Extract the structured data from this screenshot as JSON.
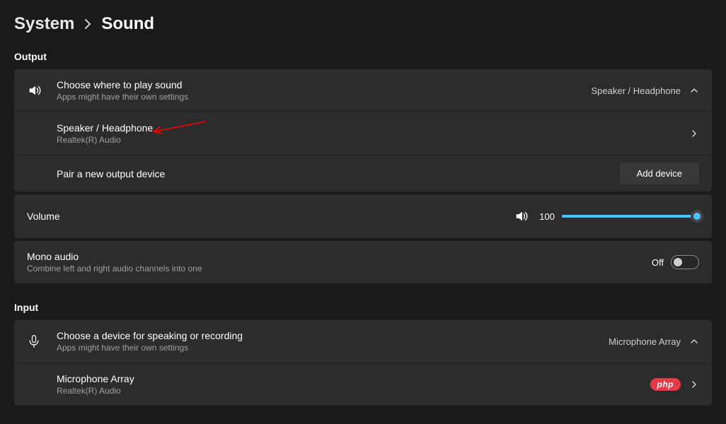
{
  "breadcrumb": {
    "parent": "System",
    "current": "Sound"
  },
  "sections": {
    "output": "Output",
    "input": "Input"
  },
  "output_header": {
    "title": "Choose where to play sound",
    "subtitle": "Apps might have their own settings",
    "value": "Speaker / Headphone"
  },
  "output_device": {
    "name": "Speaker / Headphone",
    "driver": "Realtek(R) Audio"
  },
  "pair_output": {
    "label": "Pair a new output device",
    "button": "Add device"
  },
  "volume": {
    "label": "Volume",
    "value": "100"
  },
  "mono": {
    "title": "Mono audio",
    "subtitle": "Combine left and right audio channels into one",
    "state": "Off"
  },
  "input_header": {
    "title": "Choose a device for speaking or recording",
    "subtitle": "Apps might have their own settings",
    "value": "Microphone Array"
  },
  "input_device": {
    "name": "Microphone Array",
    "driver": "Realtek(R) Audio"
  },
  "badge": {
    "php": "php"
  },
  "colors": {
    "accent": "#4cc2ff",
    "panel": "#2c2c2c",
    "bg": "#1a1a1a",
    "annotation": "#ff0000"
  },
  "chart_data": null
}
